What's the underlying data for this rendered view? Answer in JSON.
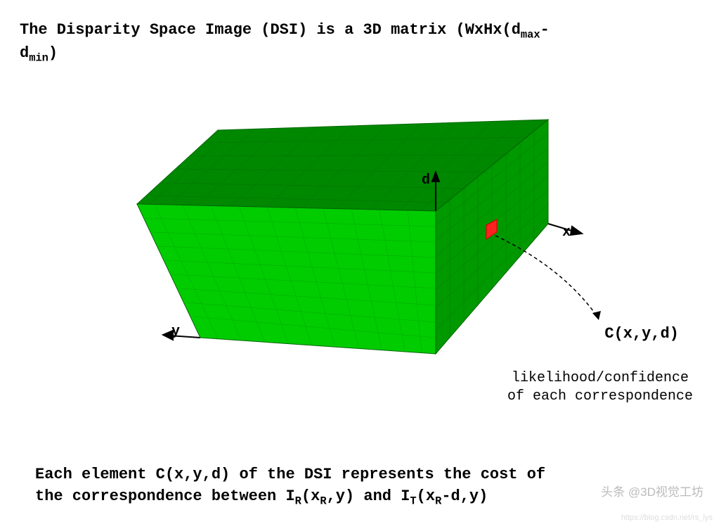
{
  "title": {
    "line1_a": "The Disparity Space Image (DSI) is a 3D matrix (WxHx(d",
    "line1_sub1": "max",
    "line1_b": "-",
    "line2_a": "d",
    "line2_sub1": "min",
    "line2_b": ")"
  },
  "axes": {
    "d": "d",
    "x": "x",
    "y": "y"
  },
  "cost_label": "C(x,y,d)",
  "likelihood": {
    "line1": "likelihood/confidence",
    "line2": "of each correspondence"
  },
  "footer": {
    "part1": "Each element C(x,y,d) of the DSI represents the cost of",
    "part2a": "the correspondence between I",
    "part2_sub1": "R",
    "part2b": "(x",
    "part2_sub2": "R",
    "part2c": ",y) and I",
    "part2_sub3": "T",
    "part2d": "(x",
    "part2_sub4": "R",
    "part2e": "-d,y)"
  },
  "watermark_top": "头条 @3D视觉工坊",
  "watermark_bottom": "https://blog.csdn.net/rs_lys",
  "colors": {
    "top_face": "#008800",
    "front_face": "#00cc00",
    "side_face": "#009900",
    "stroke": "#006600",
    "voxel": "#ff0000"
  }
}
